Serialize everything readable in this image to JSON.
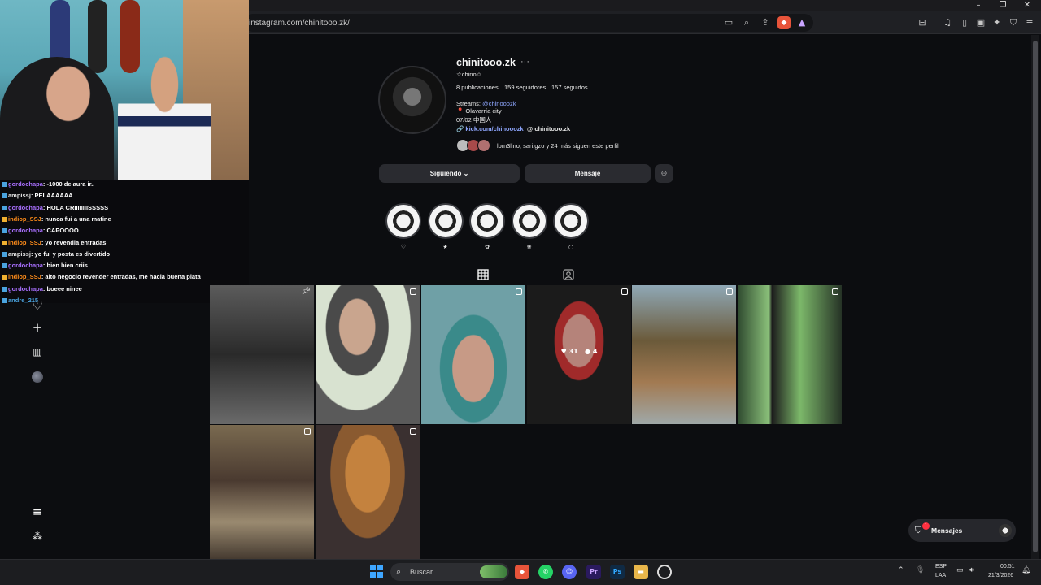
{
  "browser": {
    "url": "instagram.com/chinitooo.zk/"
  },
  "profile": {
    "username": "chinitooo.zk",
    "full_name": "☆chino☆",
    "posts": "8 publicaciones",
    "followers": "159 seguidores",
    "following": "157 seguidos",
    "bio_streams_prefix": "Streams: ",
    "bio_streams_handle": "@chinooozk",
    "bio_location": "📍 Olavarría city",
    "bio_date": "07/02 中国人",
    "bio_link": "🔗 kick.com/chinooozk",
    "threads_handle": "chinitooo.zk",
    "followed_by": "lom3lino, sari.gzo y 24 más siguen este perfil",
    "buttons": {
      "following": "Siguiendo ⌄",
      "message": "Mensaje"
    },
    "highlights": [
      {
        "label": "♡"
      },
      {
        "label": "★"
      },
      {
        "label": "✿"
      },
      {
        "label": "❀"
      },
      {
        "label": "○"
      }
    ]
  },
  "posts_grid": [
    {
      "likes": "",
      "comments": ""
    },
    {
      "likes": "",
      "comments": ""
    },
    {
      "likes": "",
      "comments": ""
    },
    {
      "likes": "31",
      "comments": "4"
    },
    {
      "likes": "",
      "comments": ""
    },
    {
      "likes": "",
      "comments": ""
    },
    {
      "likes": "",
      "comments": ""
    },
    {
      "likes": "",
      "comments": ""
    }
  ],
  "chat": [
    {
      "name": "gordochapa",
      "msg": ": -1000 de aura ir..",
      "color": "purple"
    },
    {
      "name": "ampissj",
      "msg": ": PELAAAAAA",
      "color": "white"
    },
    {
      "name": "gordochapa",
      "msg": ": HOLA CRIIIIIIIISSSSS",
      "color": "purple"
    },
    {
      "name": "indiop_SSJ",
      "msg": ": nunca fui a una matine",
      "color": "orange"
    },
    {
      "name": "gordochapa",
      "msg": ": CAPOOOO",
      "color": "purple"
    },
    {
      "name": "indiop_SSJ",
      "msg": ": yo revendia entradas",
      "color": "orange"
    },
    {
      "name": "ampissj",
      "msg": ": yo fui y posta es divertido",
      "color": "white"
    },
    {
      "name": "gordochapa",
      "msg": ": bien bien criis",
      "color": "purple"
    },
    {
      "name": "indiop_SSJ",
      "msg": ": alto negocio revender entradas, me hacia buena plata",
      "color": "orange"
    },
    {
      "name": "gordochapa",
      "msg": ": boeee ninee",
      "color": "purple"
    },
    {
      "name": "andre_215",
      "msg": "",
      "color": "blue"
    }
  ],
  "messages_pill": {
    "label": "Mensajes",
    "badge": "1"
  },
  "taskbar": {
    "search_label": "Buscar",
    "lang_top": "ESP",
    "lang_bottom": "LAA",
    "time": "00:51",
    "date": "21/3/2026"
  }
}
